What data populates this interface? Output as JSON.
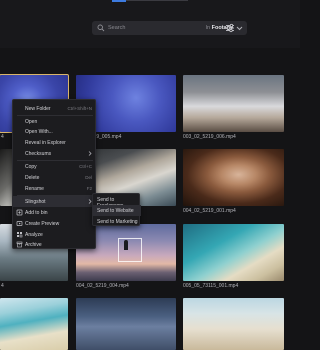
{
  "search": {
    "placeholder": "Search",
    "scope_prefix": "In",
    "scope_value": "Footage"
  },
  "assets": [
    {
      "caption": "",
      "selected": true
    },
    {
      "caption": "5219_005.mp4"
    },
    {
      "caption": "003_02_5219_006.mp4"
    },
    {
      "caption": ""
    },
    {
      "caption": ""
    },
    {
      "caption": "004_02_5219_001.mp4"
    },
    {
      "caption": ""
    },
    {
      "caption": "004_02_5219_004.mp4"
    },
    {
      "caption": "005_05_73115_001.mp4"
    },
    {
      "caption": ""
    },
    {
      "caption": ""
    },
    {
      "caption": ""
    }
  ],
  "captions_side": {
    "left_row1": "4",
    "left_row3": "4"
  },
  "context_menu": {
    "items": [
      {
        "label": "New Folder",
        "shortcut": "Ctrl+Shift+N"
      },
      {
        "label": "Open",
        "shortcut": ""
      },
      {
        "label": "Open With...",
        "shortcut": ""
      },
      {
        "label": "Reveal in Explorer",
        "shortcut": ""
      },
      {
        "label": "Checksums",
        "shortcut": ""
      },
      {
        "label": "Copy",
        "shortcut": "Ctrl+C"
      },
      {
        "label": "Delete",
        "shortcut": "Del"
      },
      {
        "label": "Rename",
        "shortcut": "F2"
      },
      {
        "label": "Slingshot",
        "shortcut": ""
      },
      {
        "label": "Add to bin",
        "shortcut": ""
      },
      {
        "label": "Create Preview",
        "shortcut": ""
      },
      {
        "label": "Analyze",
        "shortcut": ""
      },
      {
        "label": "Archive",
        "shortcut": ""
      }
    ]
  },
  "slingshot_submenu": {
    "items": [
      {
        "label": "Send to Freelancers"
      },
      {
        "label": "Send to Website"
      },
      {
        "label": "Send to Marketing"
      }
    ]
  },
  "colors": {
    "accent": "#3d7be0",
    "selection": "#d9b56a",
    "menu_bg": "#1c1c1f",
    "background": "#141416"
  },
  "icons": [
    "search-icon",
    "chevron-down-icon",
    "filter-icon",
    "chevron-right-icon",
    "bin-icon",
    "preview-icon",
    "analyze-icon",
    "archive-icon"
  ]
}
